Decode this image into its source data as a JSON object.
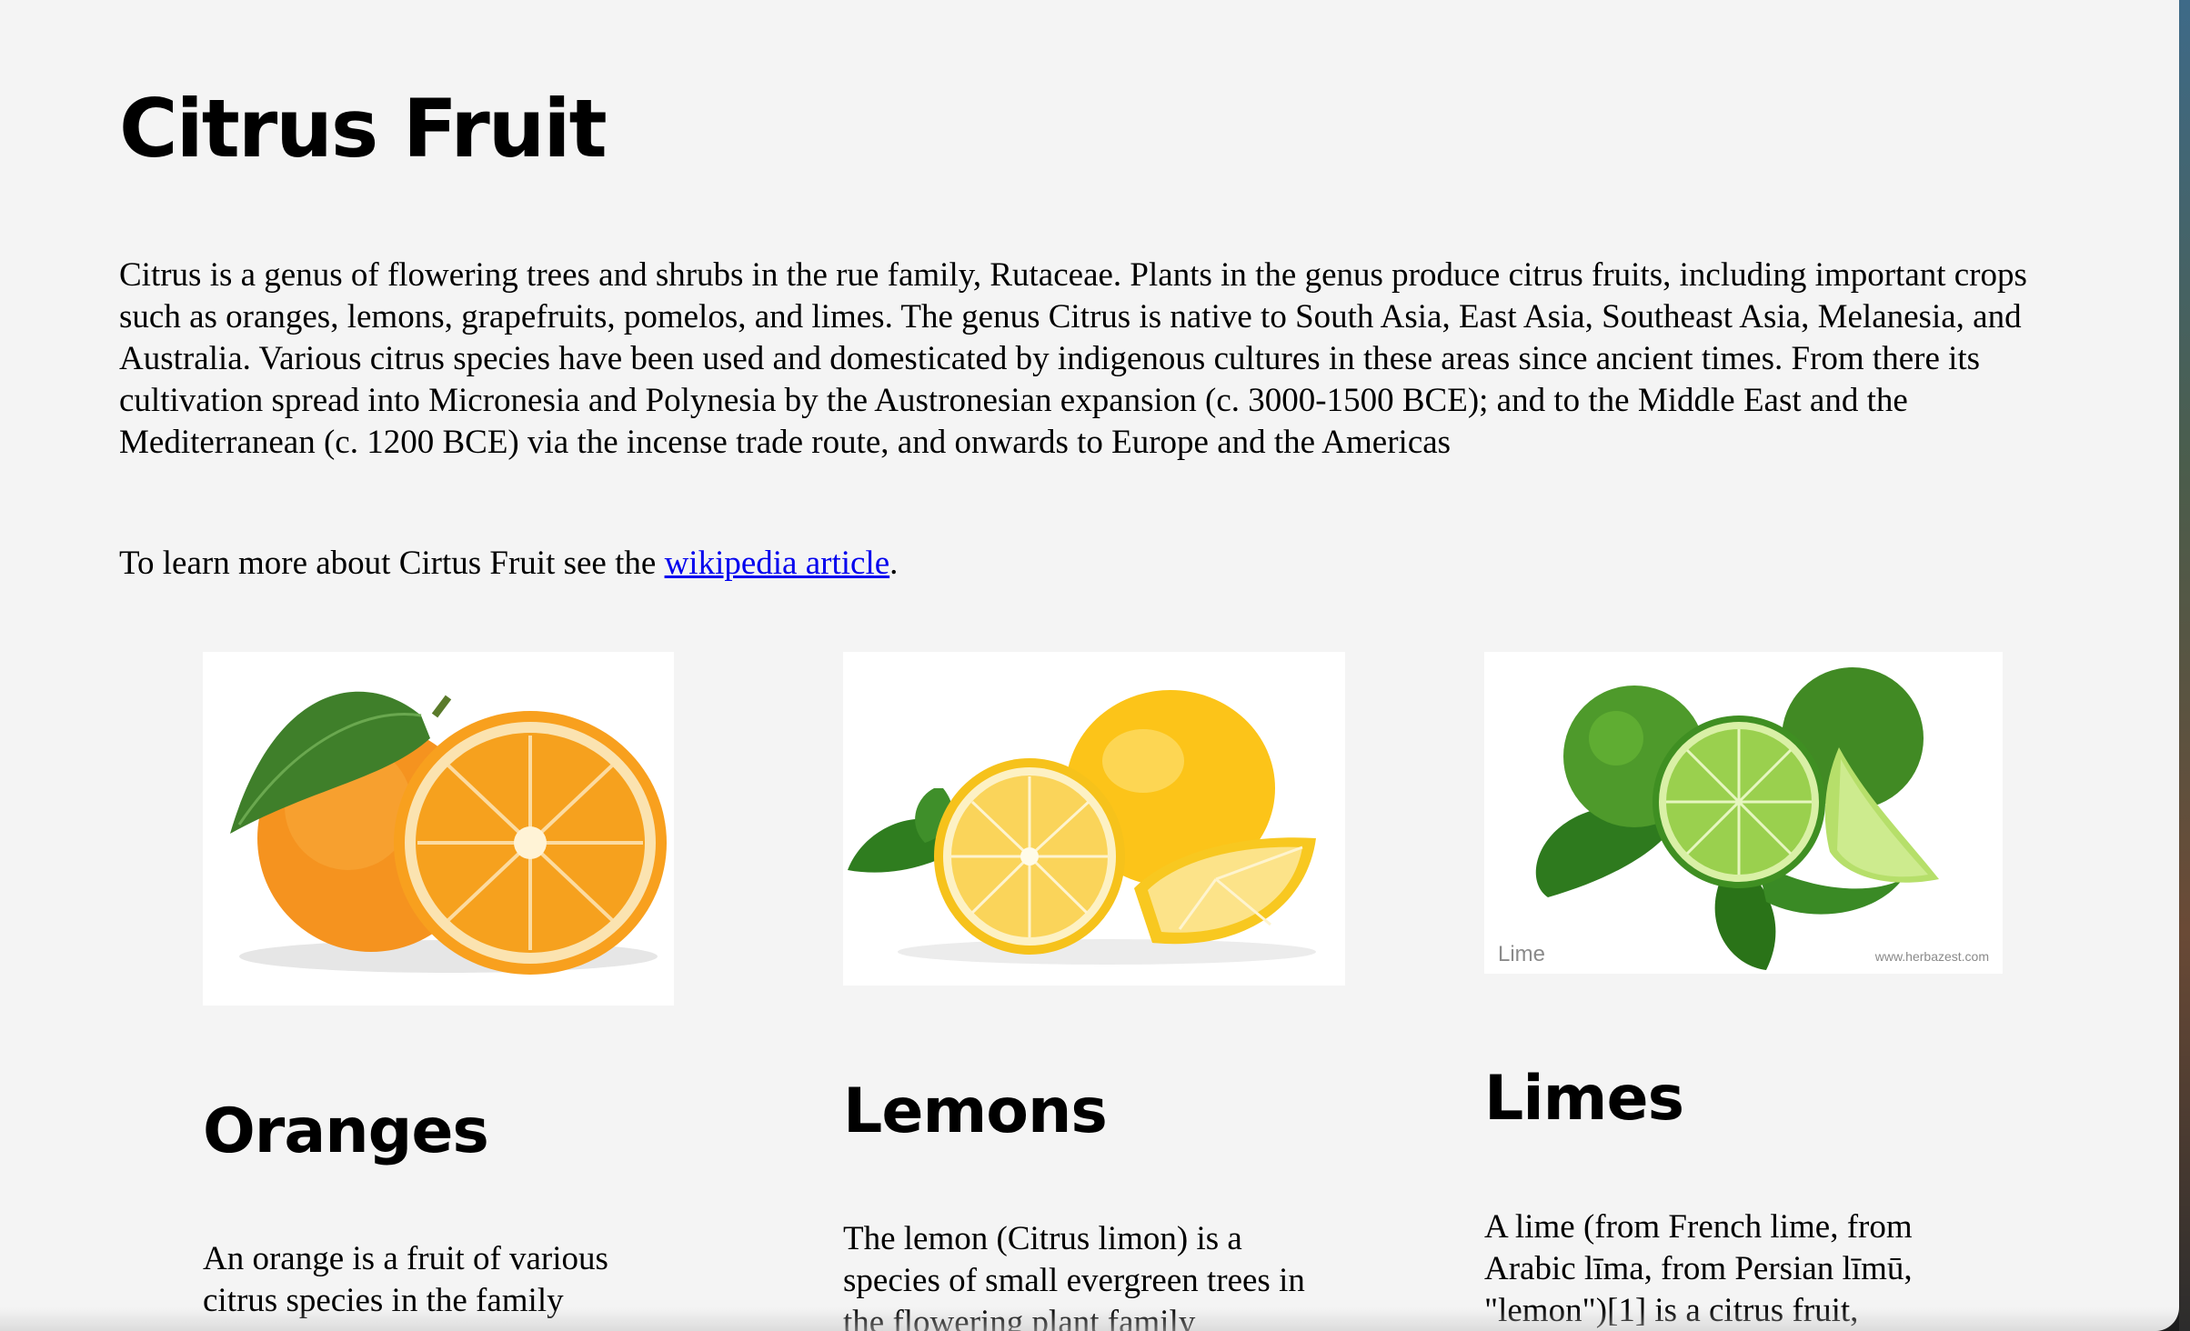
{
  "page": {
    "title": "Citrus Fruit",
    "intro": "Citrus is a genus of flowering trees and shrubs in the rue family, Rutaceae. Plants in the genus produce citrus fruits, including important crops such as oranges, lemons, grapefruits, pomelos, and limes. The genus Citrus is native to South Asia, East Asia, Southeast Asia, Melanesia, and Australia. Various citrus species have been used and domesticated by indigenous cultures in these areas since ancient times. From there its cultivation spread into Micronesia and Polynesia by the Austronesian expansion (c. 3000-1500 BCE); and to the Middle East and the Mediterranean (c. 1200 BCE) via the incense trade route, and onwards to Europe and the Americas",
    "learn_more_prefix": "To learn more about Cirtus Fruit see the ",
    "learn_more_link": "wikipedia article",
    "learn_more_suffix": "."
  },
  "cards": {
    "oranges": {
      "title": "Oranges",
      "text": "An orange is a fruit of various citrus species in the family"
    },
    "lemons": {
      "title": "Lemons",
      "text": "The lemon (Citrus limon) is a species of small evergreen trees in the flowering plant family"
    },
    "limes": {
      "title": "Limes",
      "text": "A lime (from French lime, from Arabic līma, from Persian līmū, \"lemon\")[1] is a citrus fruit,",
      "image_caption": "Lime",
      "image_watermark": "www.herbazest.com"
    }
  },
  "colors": {
    "page_bg": "#f4f4f4",
    "link": "#0000ee",
    "orange": "#f7941d",
    "lemon": "#fcd12a",
    "lime": "#6fbf3a"
  }
}
